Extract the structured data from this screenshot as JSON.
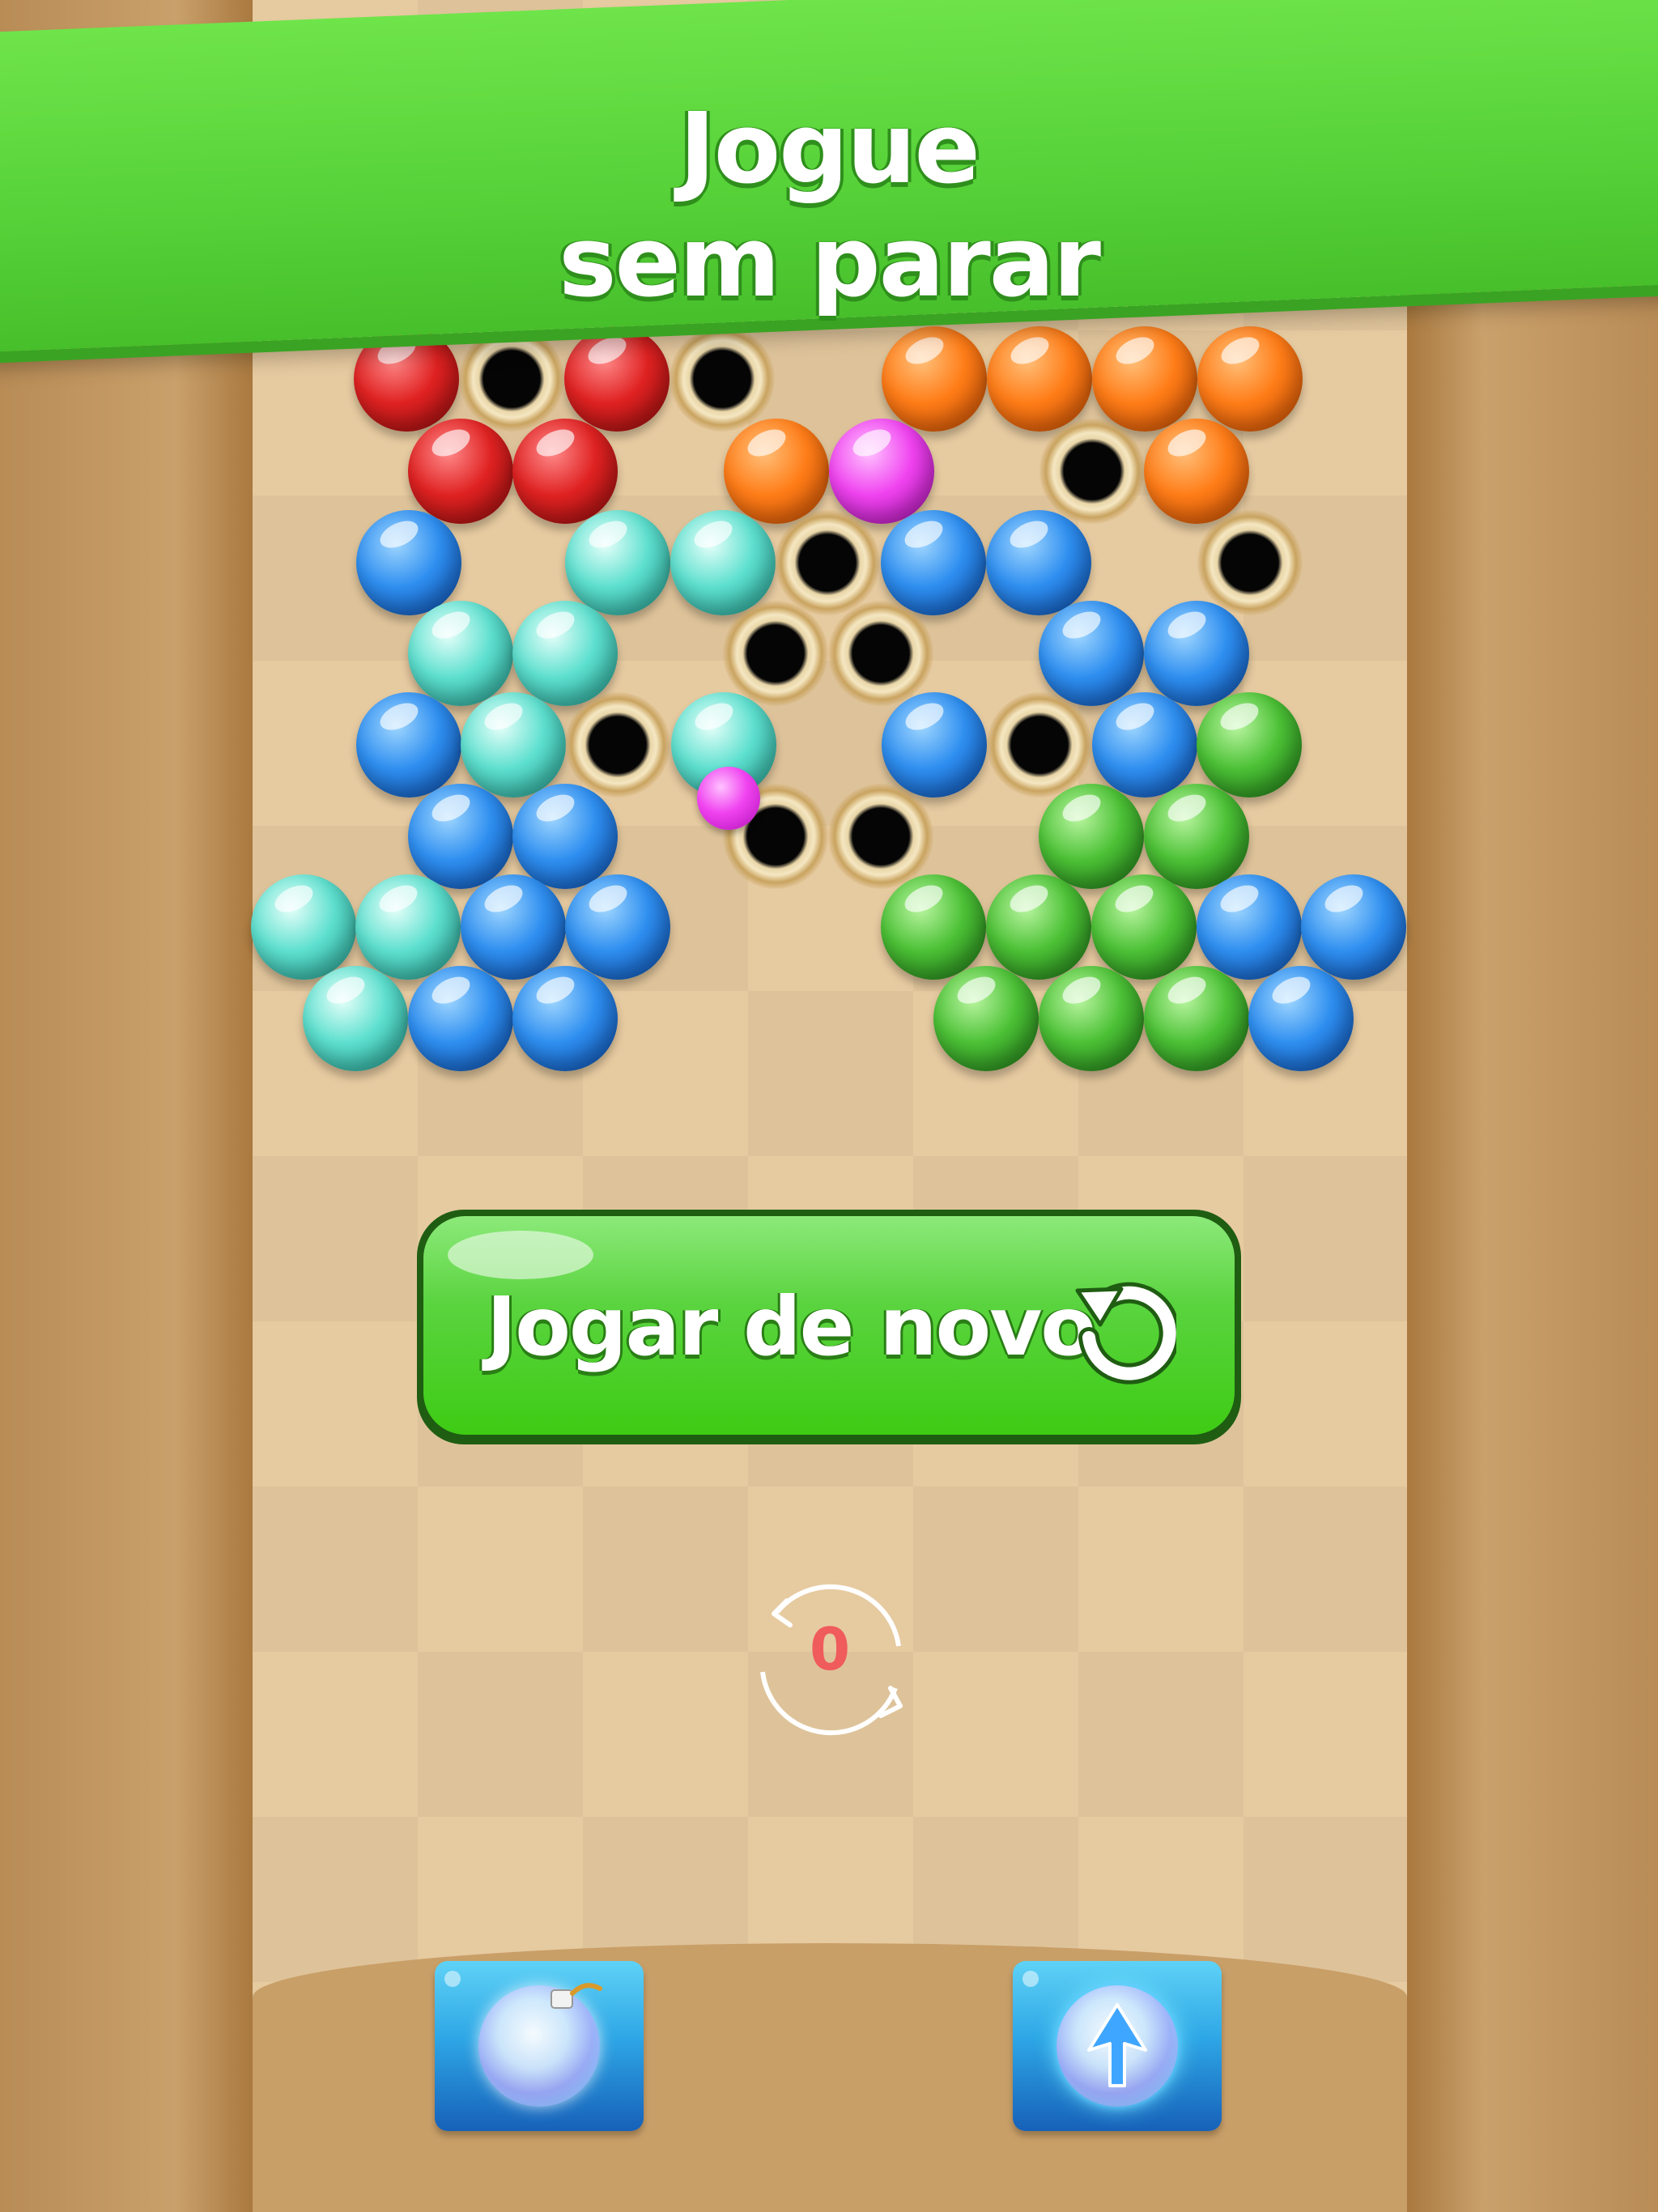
{
  "banner": {
    "line1": "Jogue",
    "line2": "sem parar"
  },
  "buttons": {
    "play_again_label": "Jogar de novo"
  },
  "counter": {
    "value": "0"
  },
  "boosters": [
    {
      "name": "bomb-bubble"
    },
    {
      "name": "lightning-arrow-bubble"
    }
  ],
  "colors": {
    "banner": "#56d138",
    "button": "#3ecb14",
    "counter_text": "#f05b5b",
    "board": "#e6caa0"
  },
  "bubble_colors": [
    "red",
    "orange",
    "blue",
    "cyan",
    "green",
    "magenta"
  ]
}
